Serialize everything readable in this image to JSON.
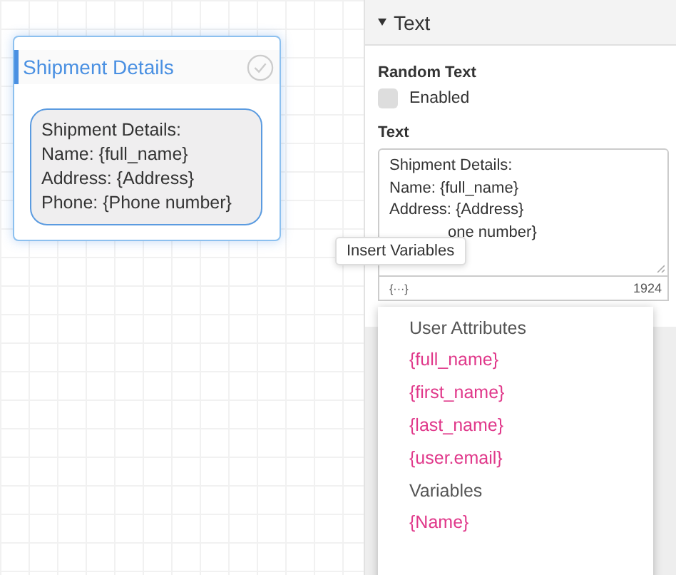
{
  "node": {
    "title": "Shipment Details",
    "checked": false,
    "message_lines": [
      "Shipment Details:",
      "Name: {full_name}",
      "Address: {Address}",
      "Phone: {Phone number}"
    ]
  },
  "panel": {
    "section_title": "Text",
    "expanded": true,
    "random_text": {
      "label": "Random Text",
      "checkbox_label": "Enabled",
      "checked": false
    },
    "text_field": {
      "label": "Text",
      "lines": [
        "Shipment Details:",
        "Name: {full_name}",
        "Address: {Address}",
        "one number}"
      ],
      "variables_button": "{···}",
      "count": "1924"
    },
    "tooltip": "Insert Variables",
    "dropdown": [
      {
        "heading": "User Attributes",
        "items": [
          "{full_name}",
          "{first_name}",
          "{last_name}",
          "{user.email}"
        ]
      },
      {
        "heading": "Variables",
        "items": [
          "{Name}"
        ]
      }
    ]
  }
}
